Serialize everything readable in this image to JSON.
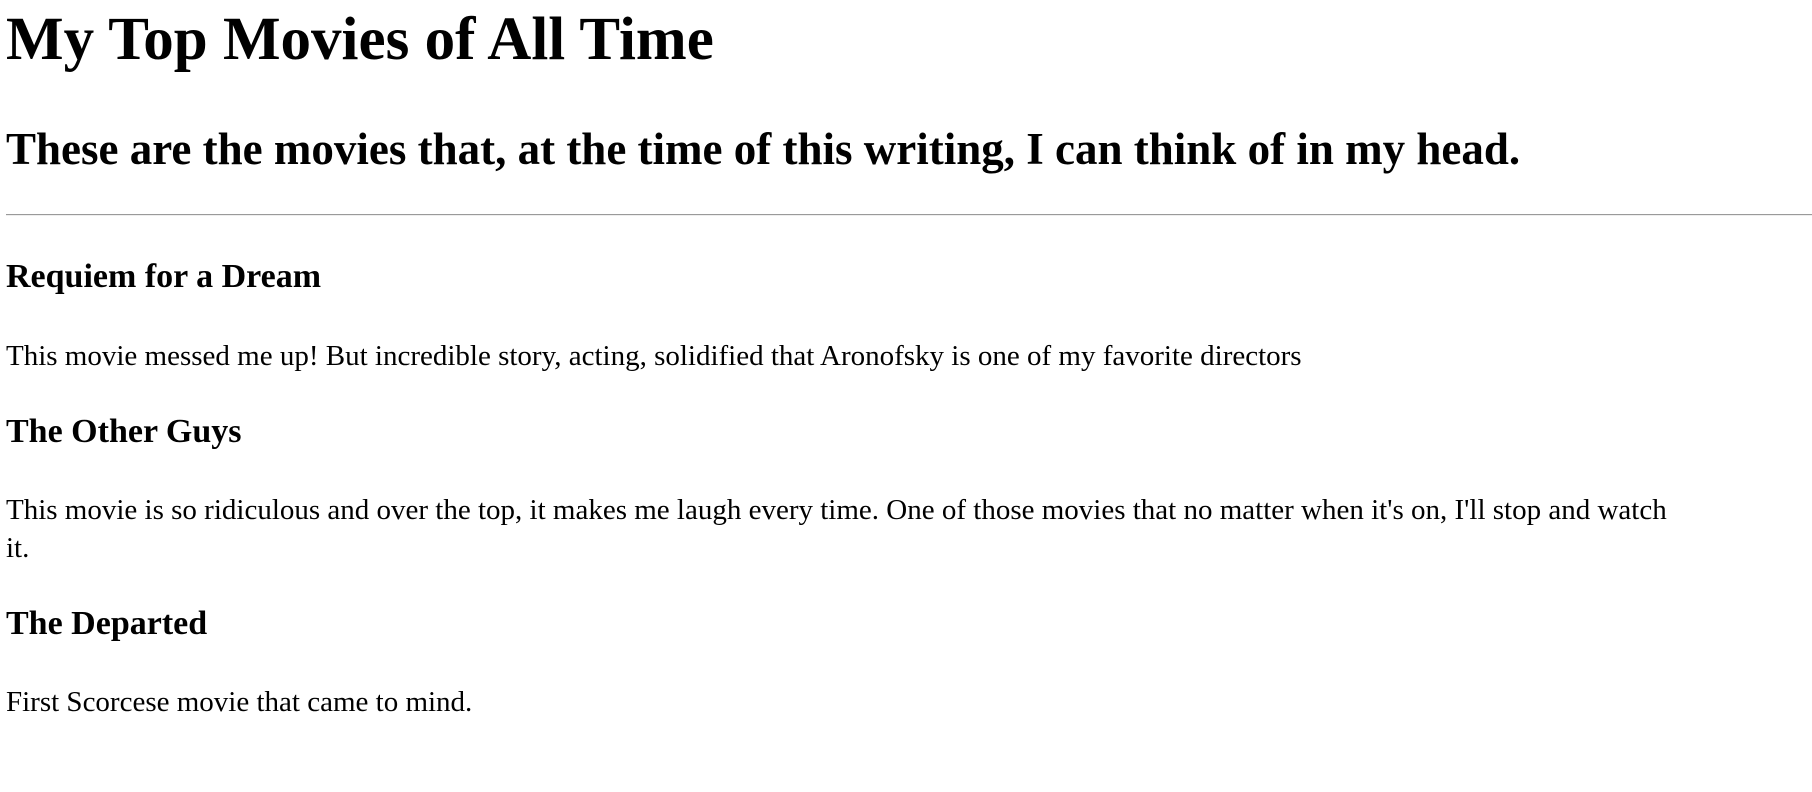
{
  "page": {
    "title": "My Top Movies of All Time",
    "subtitle": "These are the movies that, at the time of this writing, I can think of in my head."
  },
  "movies": [
    {
      "title": "Requiem for a Dream",
      "description": "This movie messed me up! But incredible story, acting, solidified that Aronofsky is one of my favorite directors"
    },
    {
      "title": "The Other Guys",
      "description_line_1": "This movie is so ridiculous and over the top, it makes me laugh every time. One of those movies that no matter when it's on, I'll stop and watch",
      "description_line_2": "it."
    },
    {
      "title": "The Departed",
      "description": "First Scorcese movie that came to mind."
    }
  ]
}
